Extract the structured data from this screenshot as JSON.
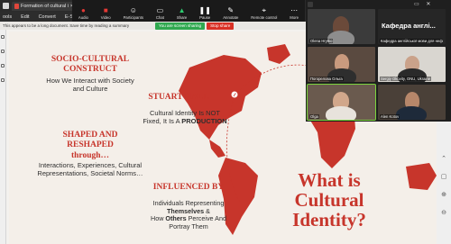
{
  "app": {
    "tab_title": "Formation of cultural i",
    "tab_close": "×",
    "tab_add": "+"
  },
  "menu": {
    "items": [
      "ools",
      "Edit",
      "Convert",
      "E-Sign"
    ]
  },
  "zoom_toolbar": {
    "items": [
      {
        "label": "Audio",
        "icon": "microphone-muted-icon",
        "glyph": "🎙"
      },
      {
        "label": "Video",
        "icon": "video-off-icon",
        "glyph": "▣"
      },
      {
        "label": "Participants",
        "icon": "participants-icon",
        "glyph": "👥"
      },
      {
        "label": "Chat",
        "icon": "chat-icon",
        "glyph": "💬"
      },
      {
        "label": "Share",
        "icon": "share-icon",
        "glyph": "⬆"
      },
      {
        "label": "Pause",
        "icon": "pause-icon",
        "glyph": "⏸"
      },
      {
        "label": "Annotate",
        "icon": "annotate-icon",
        "glyph": "✎"
      },
      {
        "label": "Remote control",
        "icon": "remote-control-icon",
        "glyph": "🖱"
      },
      {
        "label": "More",
        "icon": "more-icon",
        "glyph": "…"
      }
    ],
    "sharing_text": "You are screen sharing",
    "stop_share": "Stop share"
  },
  "notice": {
    "text": "This appears to be a long document. Save time by reading a summary"
  },
  "slide": {
    "heading1": "SOCIO-CULTURAL CONSTRUCT",
    "body1": "How We Interact with Society and Culture",
    "heading2": "STUART HALL",
    "body2_line1": "Cultural Identity Is NOT",
    "body2_line2_prefix": "Fixed, It Is A ",
    "body2_line2_bold": "PRODUCTION",
    "heading3_line1": "SHAPED AND",
    "heading3_line2": "RESHAPED",
    "heading3_line3": "through…",
    "body3": "Interactions, Experiences, Cultural Representations, Societal Norms…",
    "heading4": "INFLUENCED BY",
    "body4_line1": "Individuals Representing",
    "body4_bold": "Themselves",
    "body4_amp": " &",
    "body4_line3_prefix": "How ",
    "body4_line3_bold": "Others",
    "body4_line3_suffix": " Perceive And",
    "body4_line4": "Portray Them",
    "big_question": "What is Cultural Identity?"
  },
  "gallery": {
    "tiles": [
      {
        "name": "Olena Hrytko",
        "kind": "video"
      },
      {
        "name": "Кафедра англійської мови для нефі...",
        "big": "Кафедра англі...",
        "kind": "name"
      },
      {
        "name": "Погорелова Ольга",
        "kind": "video"
      },
      {
        "name": "Sergiy Okovity, ONU, Ukraine",
        "kind": "video"
      },
      {
        "name": "Olga",
        "kind": "video"
      },
      {
        "name": "Alen Kotov",
        "kind": "video"
      }
    ]
  },
  "colors": {
    "accent_red": "#c7352b",
    "share_green": "#2fa84f",
    "stop_red": "#d93025",
    "active_speaker": "#7bd43d"
  }
}
